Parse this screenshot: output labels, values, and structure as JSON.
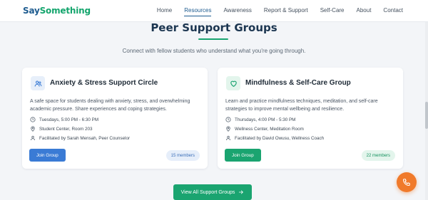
{
  "brand": {
    "part1": "Say",
    "part2": "Something"
  },
  "nav": {
    "items": [
      "Home",
      "Resources",
      "Awareness",
      "Report & Support",
      "Self-Care",
      "About",
      "Contact"
    ],
    "active": "Resources"
  },
  "section": {
    "title": "Peer Support Groups",
    "subtitle": "Connect with fellow students who understand what you're going through."
  },
  "groups": [
    {
      "title": "Anxiety & Stress Support Circle",
      "description": "A safe space for students dealing with anxiety, stress, and overwhelming academic pressure. Share experiences and coping strategies.",
      "schedule": "Tuesdays, 5:00 PM - 6:30 PM",
      "location": "Student Center, Room 203",
      "facilitator": "Facilitated by Sarah Mensah, Peer Counselor",
      "join_label": "Join Group",
      "members": "15 members",
      "accent": "#3a7bd5",
      "icon": "users-icon"
    },
    {
      "title": "Mindfulness & Self-Care Group",
      "description": "Learn and practice mindfulness techniques, meditation, and self-care strategies to improve mental wellbeing and resilience.",
      "schedule": "Thursdays, 4:00 PM - 5:30 PM",
      "location": "Wellness Center, Meditation Room",
      "facilitator": "Facilitated by David Owusu, Wellness Coach",
      "join_label": "Join Group",
      "members": "22 members",
      "accent": "#1aa470",
      "icon": "heart-icon"
    }
  ],
  "cta": {
    "label": "View All Support Groups"
  },
  "colors": {
    "brand_blue": "#1d5b8f",
    "brand_green": "#14a56d",
    "fab_orange": "#f07a2b"
  }
}
